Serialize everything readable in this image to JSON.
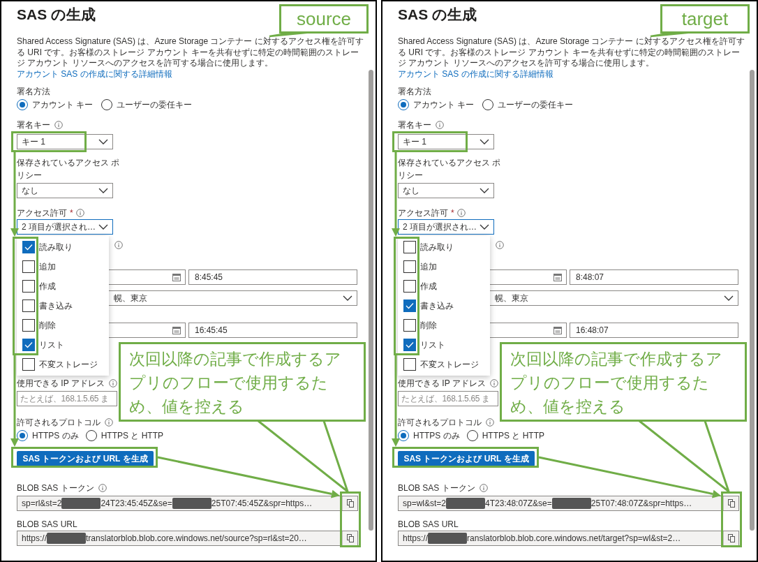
{
  "panels": [
    {
      "title": "SAS の生成",
      "callout_label": "source",
      "description": "Shared Access Signature (SAS) は、Azure Storage コンテナー に対するアクセス権を許可する URI です。お客様のストレージ アカウント キーを共有せずに特定の時間範囲のストレージ アカウント リソースへのアクセスを許可する場合に使用します。",
      "description_link": "アカウント SAS の作成に関する詳細情報",
      "signing_method": {
        "label": "署名方法",
        "options": [
          {
            "label": "アカウント キー",
            "selected": true
          },
          {
            "label": "ユーザーの委任キー",
            "selected": false
          }
        ]
      },
      "signing_key": {
        "label": "署名キー",
        "value": "キー 1"
      },
      "stored_policy": {
        "label": "保存されているアクセス ポリシー",
        "value": "なし"
      },
      "permissions": {
        "label": "アクセス許可",
        "required_mark": "*",
        "value": "2 項目が選択され…",
        "expanded": true,
        "options": [
          {
            "label": "読み取り",
            "checked": true
          },
          {
            "label": "追加",
            "checked": false
          },
          {
            "label": "作成",
            "checked": false
          },
          {
            "label": "書き込み",
            "checked": false
          },
          {
            "label": "削除",
            "checked": false
          },
          {
            "label": "リスト",
            "checked": true
          },
          {
            "label": "不変ストレージ",
            "checked": false
          }
        ]
      },
      "start_time": "8:45:45",
      "timezone": "幌、東京",
      "expiry_time": "16:45:45",
      "ip": {
        "label": "使用できる IP アドレス",
        "placeholder": "たとえば、168.1.5.65 ま"
      },
      "protocol": {
        "label": "許可されるプロトコル",
        "options": [
          {
            "label": "HTTPS のみ",
            "selected": true
          },
          {
            "label": "HTTPS と HTTP",
            "selected": false
          }
        ]
      },
      "generate_button": "SAS トークンおよび URL を生成",
      "token": {
        "label": "BLOB SAS トークン",
        "segments": [
          {
            "kind": "text",
            "text": "sp=rl&st=2"
          },
          {
            "kind": "redacted"
          },
          {
            "kind": "text",
            "text": "24T23:45:45Z&se="
          },
          {
            "kind": "redacted"
          },
          {
            "kind": "text",
            "text": "25T07:45:45Z&spr=https…"
          }
        ]
      },
      "url": {
        "label": "BLOB SAS URL",
        "segments": [
          {
            "kind": "text",
            "text": "https://"
          },
          {
            "kind": "redacted"
          },
          {
            "kind": "text",
            "text": "translatorblob.blob.core.windows.net/source?sp=rl&st=20…"
          }
        ]
      },
      "note": "次回以降の記事で作成するアプリのフローで使用するため、値を控える"
    },
    {
      "title": "SAS の生成",
      "callout_label": "target",
      "description": "Shared Access Signature (SAS) は、Azure Storage コンテナー に対するアクセス権を許可する URI です。お客様のストレージ アカウント キーを共有せずに特定の時間範囲のストレージ アカウント リソースへのアクセスを許可する場合に使用します。",
      "description_link": "アカウント SAS の作成に関する詳細情報",
      "signing_method": {
        "label": "署名方法",
        "options": [
          {
            "label": "アカウント キー",
            "selected": true
          },
          {
            "label": "ユーザーの委任キー",
            "selected": false
          }
        ]
      },
      "signing_key": {
        "label": "署名キー",
        "value": "キー 1"
      },
      "stored_policy": {
        "label": "保存されているアクセス ポリシー",
        "value": "なし"
      },
      "permissions": {
        "label": "アクセス許可",
        "required_mark": "*",
        "value": "2 項目が選択され…",
        "expanded": true,
        "options": [
          {
            "label": "読み取り",
            "checked": false
          },
          {
            "label": "追加",
            "checked": false
          },
          {
            "label": "作成",
            "checked": false
          },
          {
            "label": "書き込み",
            "checked": true
          },
          {
            "label": "削除",
            "checked": false
          },
          {
            "label": "リスト",
            "checked": true
          },
          {
            "label": "不変ストレージ",
            "checked": false
          }
        ]
      },
      "start_time": "8:48:07",
      "timezone": "幌、東京",
      "expiry_time": "16:48:07",
      "ip": {
        "label": "使用できる IP アドレス",
        "placeholder": "たとえば、168.1.5.65 ま"
      },
      "protocol": {
        "label": "許可されるプロトコル",
        "options": [
          {
            "label": "HTTPS のみ",
            "selected": true
          },
          {
            "label": "HTTPS と HTTP",
            "selected": false
          }
        ]
      },
      "generate_button": "SAS トークンおよび URL を生成",
      "token": {
        "label": "BLOB SAS トークン",
        "segments": [
          {
            "kind": "text",
            "text": "sp=wl&st=2"
          },
          {
            "kind": "redacted"
          },
          {
            "kind": "text",
            "text": "4T23:48:07Z&se="
          },
          {
            "kind": "redacted"
          },
          {
            "kind": "text",
            "text": "25T07:48:07Z&spr=https…"
          }
        ]
      },
      "url": {
        "label": "BLOB SAS URL",
        "segments": [
          {
            "kind": "text",
            "text": "https://"
          },
          {
            "kind": "redacted"
          },
          {
            "kind": "text",
            "text": "ranslatorblob.blob.core.windows.net/target?sp=wl&st=2…"
          }
        ]
      },
      "note": "次回以降の記事で作成するアプリのフローで使用するため、値を控える"
    }
  ]
}
